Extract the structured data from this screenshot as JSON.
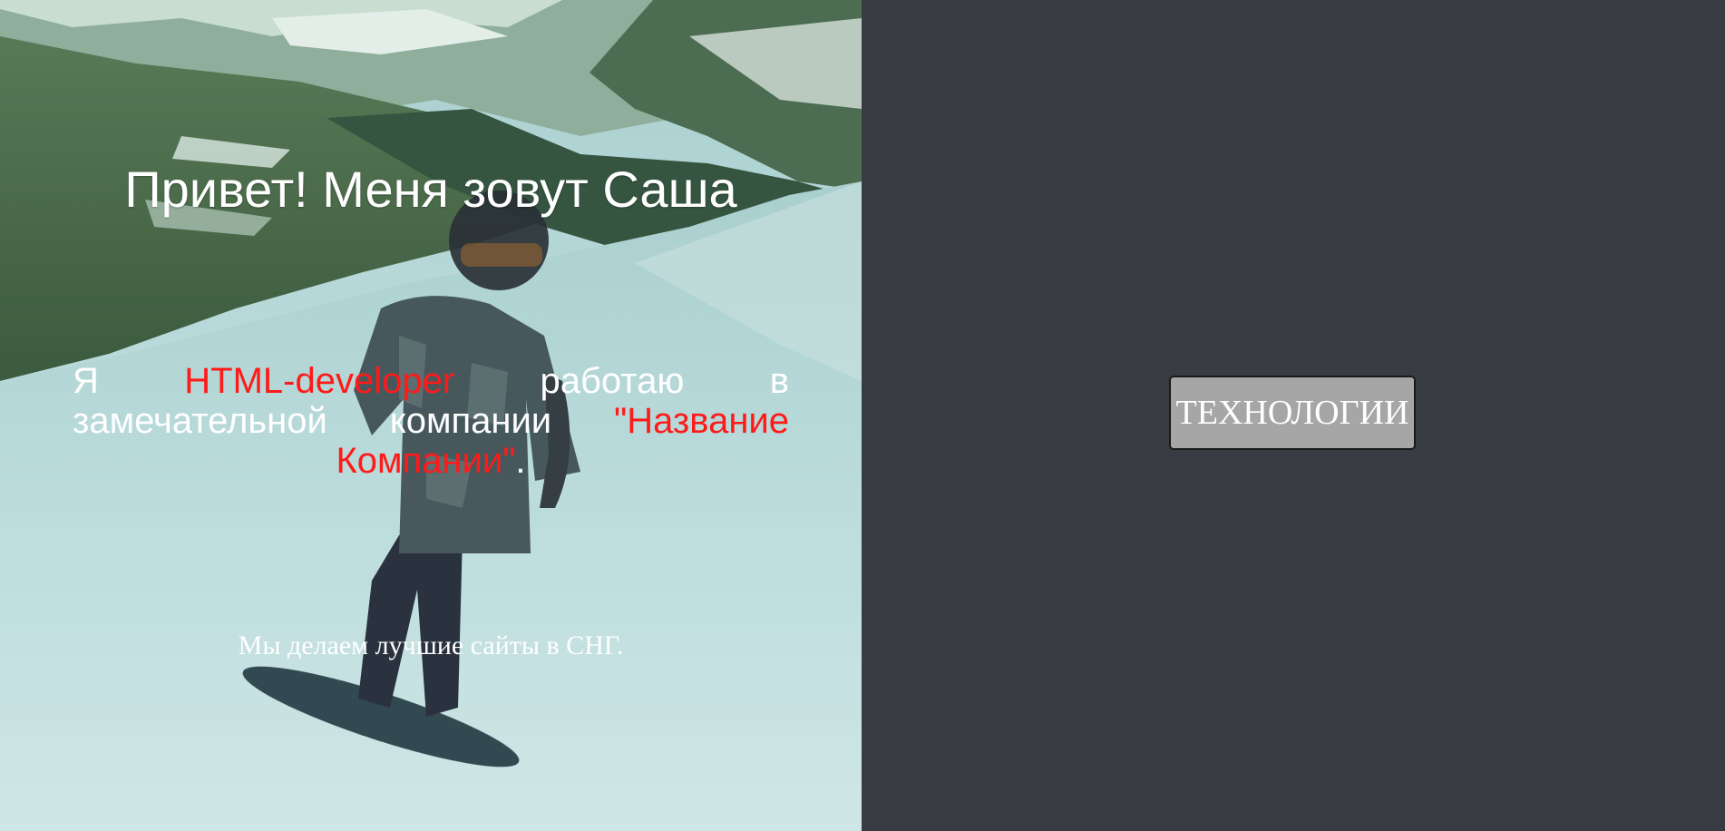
{
  "hero": {
    "title": "Привет! Меня зовут Саша",
    "intro": {
      "part1": "Я ",
      "role": "HTML-developer",
      "part2": " работаю в замечательной компании ",
      "company": "\"Название Компании\"",
      "part3": "."
    },
    "tagline": "Мы делаем лучшие сайты в СНГ.",
    "photo": "snowboarder-on-mountain-slope"
  },
  "side": {
    "button_label": "ТЕХНОЛОГИИ"
  },
  "colors": {
    "accent": "#ff1a1a",
    "side_background": "#383c42",
    "button_background": "#a6a6a6",
    "text": "#ffffff"
  }
}
